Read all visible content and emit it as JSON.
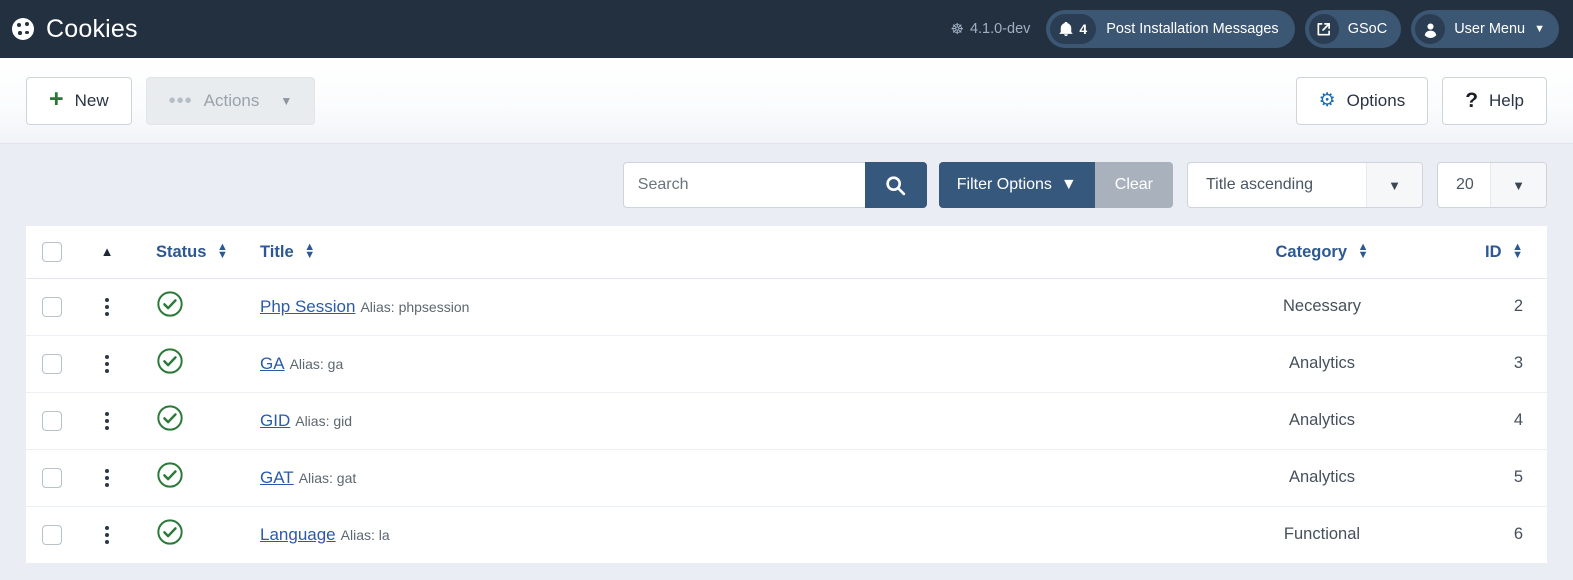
{
  "header": {
    "brand_icon": "cookie-icon",
    "title": "Cookies",
    "version_icon": "joomla-logo-icon",
    "version": "4.1.0-dev",
    "notifications": {
      "icon": "bell-icon",
      "count": "4",
      "label": "Post Installation Messages"
    },
    "gsoc": {
      "icon": "external-link-icon",
      "label": "GSoC"
    },
    "user_menu": {
      "icon": "user-avatar-icon",
      "label": "User Menu",
      "chevron": "chevron-down-icon"
    }
  },
  "toolbar": {
    "new_label": "New",
    "new_icon": "plus-icon",
    "actions_label": "Actions",
    "actions_icon": "ellipsis-horizontal-icon",
    "actions_chevron": "chevron-down-icon",
    "options_label": "Options",
    "options_icon": "gear-icon",
    "help_label": "Help",
    "help_icon": "question-mark-icon"
  },
  "filters": {
    "search_placeholder": "Search",
    "search_value": "",
    "search_icon": "search-icon",
    "filter_options_label": "Filter Options",
    "filter_options_chevron": "chevron-down-icon",
    "clear_label": "Clear",
    "sort_value": "Title ascending",
    "sort_chevron": "chevron-down-icon",
    "limit_value": "20",
    "limit_chevron": "chevron-down-icon"
  },
  "table": {
    "columns": {
      "check": "",
      "order": "ordering",
      "status": "Status",
      "title": "Title",
      "category": "Category",
      "id": "ID"
    },
    "rows": [
      {
        "status_icon": "published-check-icon",
        "title": "Php Session",
        "alias": "Alias: phpsession",
        "category": "Necessary",
        "id": "2"
      },
      {
        "status_icon": "published-check-icon",
        "title": "GA",
        "alias": "Alias: ga",
        "category": "Analytics",
        "id": "3"
      },
      {
        "status_icon": "published-check-icon",
        "title": "GID",
        "alias": "Alias: gid",
        "category": "Analytics",
        "id": "4"
      },
      {
        "status_icon": "published-check-icon",
        "title": "GAT",
        "alias": "Alias: gat",
        "category": "Analytics",
        "id": "5"
      },
      {
        "status_icon": "published-check-icon",
        "title": "Language",
        "alias": "Alias: la",
        "category": "Functional",
        "id": "6"
      }
    ]
  },
  "colors": {
    "header_bg": "#23303f",
    "accent_blue": "#36587d",
    "link_blue": "#2b5ba8",
    "status_green": "#2b7a39",
    "page_bg": "#eaeef4"
  }
}
